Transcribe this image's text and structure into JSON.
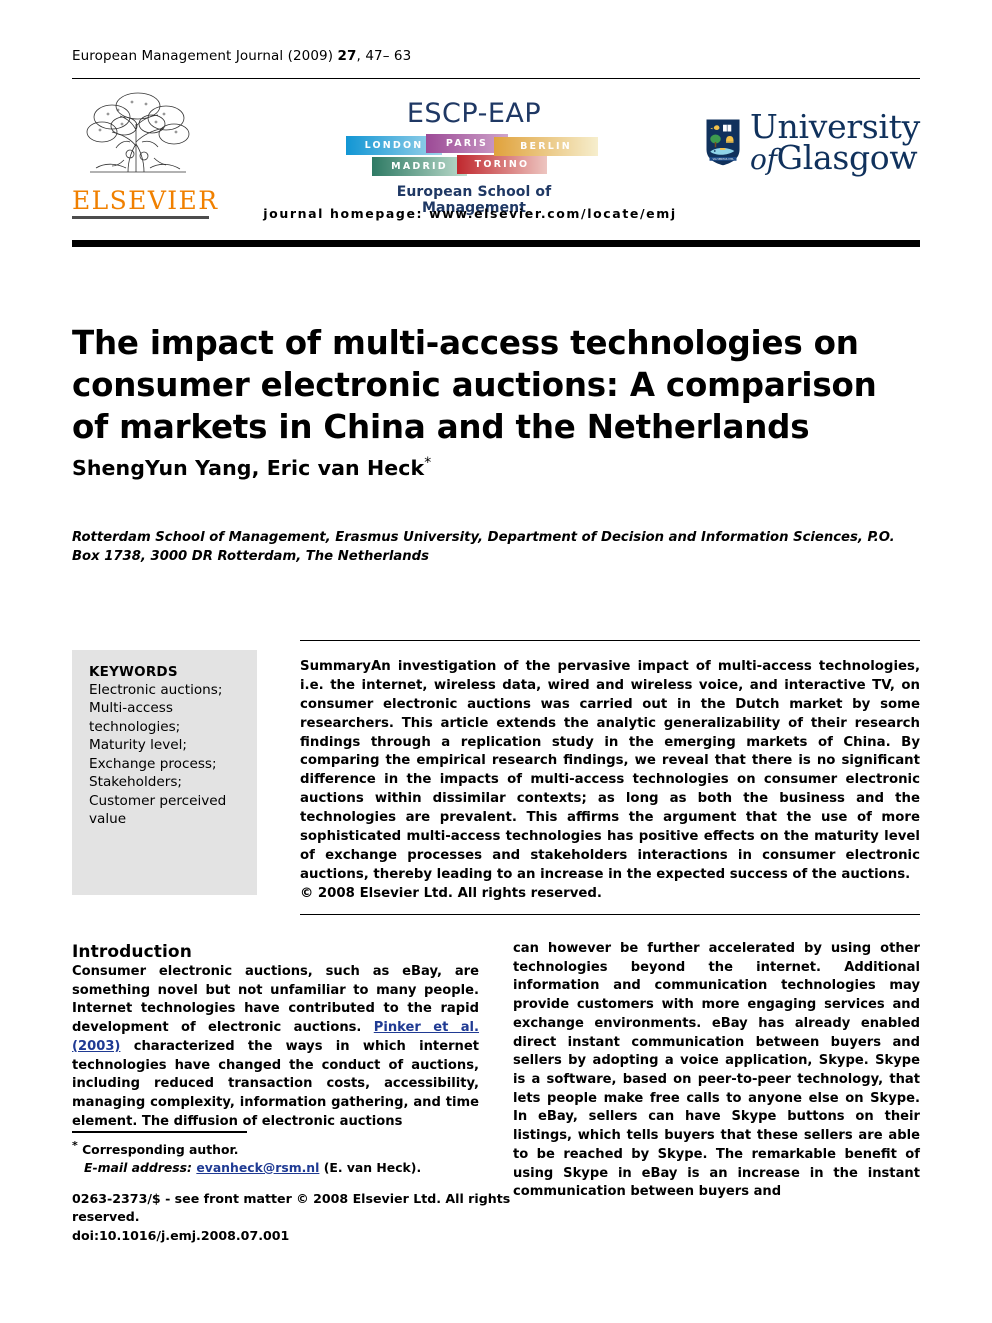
{
  "running_head": {
    "journal": "European Management Journal",
    "year": "(2009)",
    "volume": "27",
    "pages": ", 47– 63"
  },
  "masthead": {
    "elsevier": {
      "wordmark": "ELSEVIER",
      "color": "#f08000"
    },
    "escp": {
      "title": "ESCP-EAP",
      "cities": [
        "LONDON",
        "PARIS",
        "BERLIN",
        "MADRID",
        "TORINO"
      ],
      "subtitle": "European School of Management",
      "color": "#1f3864"
    },
    "glasgow": {
      "line1": "University",
      "line2_italic": "of",
      "line2": "Glasgow",
      "motto": "VIA VERITAS VITA",
      "color": "#10315c"
    },
    "homepage": "journal homepage: www.elsevier.com/locate/emj"
  },
  "article": {
    "title": "The impact of multi-access technologies on consumer electronic auctions: A comparison of markets in China and the Netherlands",
    "authors": "ShengYun Yang, Eric van Heck",
    "author_marker": "*",
    "affiliation": "Rotterdam School of Management, Erasmus University, Department of Decision and Information Sciences, P.O. Box 1738, 3000 DR Rotterdam, The Netherlands"
  },
  "keywords": {
    "heading": "KEYWORDS",
    "items": [
      "Electronic auctions;",
      "Multi-access",
      "technologies;",
      "Maturity level;",
      "Exchange process;",
      "Stakeholders;",
      "Customer perceived",
      "value"
    ]
  },
  "abstract": {
    "label": "Summary",
    "text": "An investigation of the pervasive impact of multi-access technologies, i.e. the internet, wireless data, wired and wireless voice, and interactive TV, on consumer electronic auctions was carried out in the Dutch market by some researchers. This article extends the analytic generalizability of their research findings through a replication study in the emerging markets of China. By comparing the empirical research findings, we reveal that there is no significant difference in the impacts of multi-access technologies on consumer electronic auctions within dissimilar contexts; as long as both the business and the technologies are prevalent. This affirms the argument that the use of more sophisticated multi-access technologies has positive effects on the maturity level of exchange processes and stakeholders interactions in consumer electronic auctions, thereby leading to an increase in the expected success of the auctions.",
    "copyright": "© 2008 Elsevier Ltd. All rights reserved."
  },
  "body": {
    "section_heading": "Introduction",
    "left_column_part1": "Consumer electronic auctions, such as eBay, are something novel but not unfamiliar to many people. Internet technologies have contributed to the rapid development of electronic auctions. ",
    "left_column_citation": "Pinker et al. (2003)",
    "left_column_part2": " characterized the ways in which internet technologies have changed the conduct of auctions, including reduced transaction costs, accessibility, managing complexity, information gathering, and time element. The diffusion of electronic auctions",
    "right_column": "can however be further accelerated by using other technologies beyond the internet. Additional information and communication technologies may provide customers with more engaging services and exchange environments. eBay has already enabled direct instant communication between buyers and sellers by adopting a voice application, Skype. Skype is a software, based on peer-to-peer technology, that lets people make free calls to anyone else on Skype. In eBay, sellers can have Skype buttons on their listings, which tells buyers that these sellers are able to be reached by Skype. The remarkable benefit of using Skype in eBay is an increase in the instant communication between buyers and"
  },
  "footnote": {
    "corresponding": "Corresponding author.",
    "email_label": "E-mail address:",
    "email": "evanheck@rsm.nl",
    "email_suffix": " (E. van Heck)."
  },
  "footer": {
    "line1": "0263-2373/$ - see front matter © 2008 Elsevier Ltd. All rights reserved.",
    "line2": "doi:10.1016/j.emj.2008.07.001"
  }
}
